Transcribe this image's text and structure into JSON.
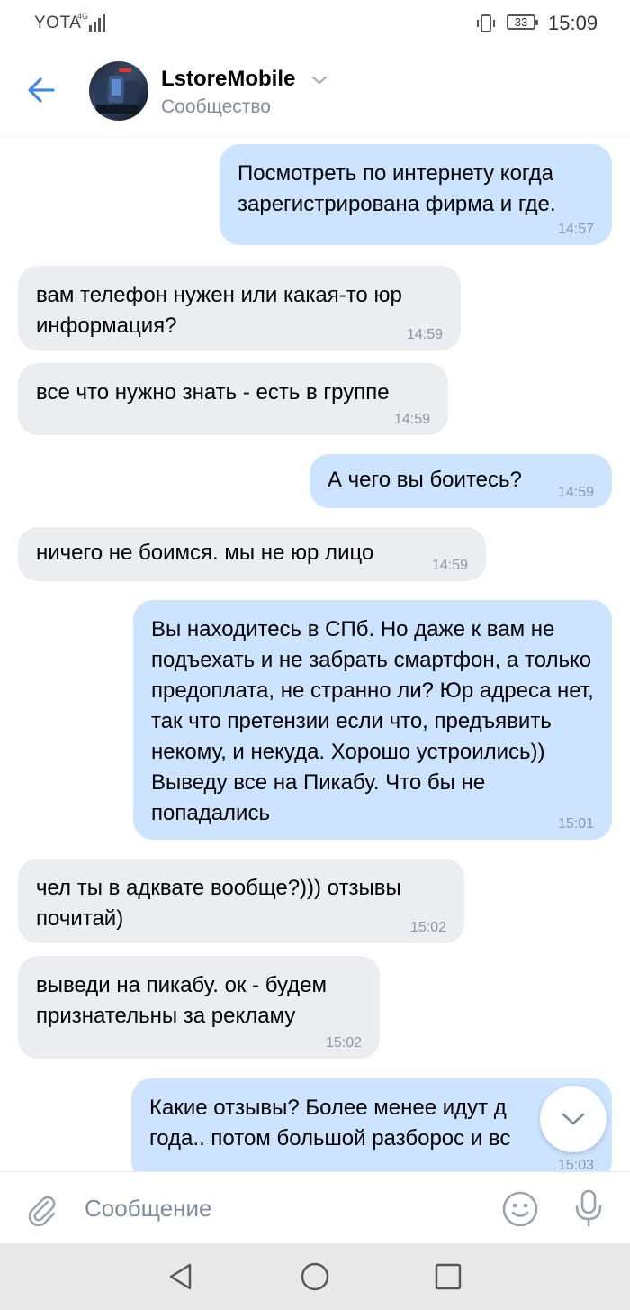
{
  "status_bar": {
    "carrier": "YOTA",
    "network": "4G",
    "battery": "33",
    "time": "15:09"
  },
  "header": {
    "title": "LstoreMobile",
    "subtitle": "Сообщество"
  },
  "messages": [
    {
      "direction": "out",
      "text": "Посмотреть по интернету когда зарегистрирована фирма и где.",
      "time": "14:57"
    },
    {
      "direction": "in",
      "text": "вам телефон нужен или какая-то юр информация?",
      "time": "14:59"
    },
    {
      "direction": "in",
      "text": "все что нужно знать - есть в группе",
      "time": "14:59"
    },
    {
      "direction": "out",
      "text": "А чего вы боитесь?",
      "time": "14:59"
    },
    {
      "direction": "in",
      "text": "ничего не боимся. мы не юр лицо",
      "time": "14:59"
    },
    {
      "direction": "out",
      "text": "Вы находитесь в СПб. Но даже к вам не подъехать и не забрать смартфон, а только предоплата, не странно ли? Юр адреса нет, так что претензии если что, предъявить некому, и некуда. Хорошо устроились)) Выведу все на Пикабу. Что бы не попадались",
      "time": "15:01"
    },
    {
      "direction": "in",
      "text": "чел ты в адквате вообще?))) отзывы почитай)",
      "time": "15:02"
    },
    {
      "direction": "in",
      "text": "выведи на пикабу. ок - будем признательны за рекламу",
      "time": "15:02"
    },
    {
      "direction": "out",
      "text": "Какие отзывы? Более менее идут д года.. потом большой разборос и вс",
      "time": "15:03"
    }
  ],
  "composer": {
    "placeholder": "Сообщение"
  },
  "colors": {
    "accent": "#3f8ae0",
    "outgoing_bubble": "#cce4ff",
    "incoming_bubble": "#ebedf0",
    "secondary_text": "#818c99"
  },
  "icons": {
    "back": "arrow-left-icon",
    "dropdown": "chevron-down-icon",
    "scroll_down": "chevron-down-icon",
    "attach": "paperclip-icon",
    "emoji": "smile-icon",
    "mic": "microphone-icon"
  }
}
